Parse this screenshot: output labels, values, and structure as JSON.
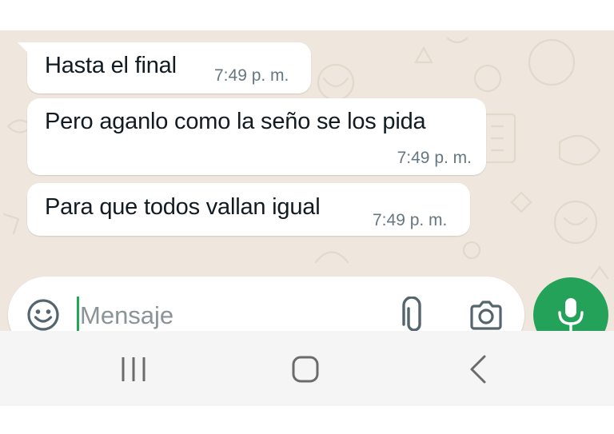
{
  "messages": [
    {
      "text": "Hasta el final",
      "time": "7:49 p. m."
    },
    {
      "text": "Pero aganlo como la seño se los pida",
      "time": "7:49 p. m."
    },
    {
      "text": "Para que todos vallan igual",
      "time": "7:49 p. m."
    }
  ],
  "composer": {
    "placeholder": "Mensaje",
    "emoji_icon": "emoji-icon",
    "attach_icon": "paperclip-icon",
    "camera_icon": "camera-icon",
    "send_icon": "microphone-icon"
  },
  "nav": {
    "recents_icon": "recents-icon",
    "home_icon": "home-icon",
    "back_icon": "back-icon"
  },
  "colors": {
    "chat_background": "#efe7dd",
    "bubble": "#ffffff",
    "timestamp": "#667781",
    "accent_green": "#25a25a",
    "nav_bar": "#f5f5f5"
  }
}
